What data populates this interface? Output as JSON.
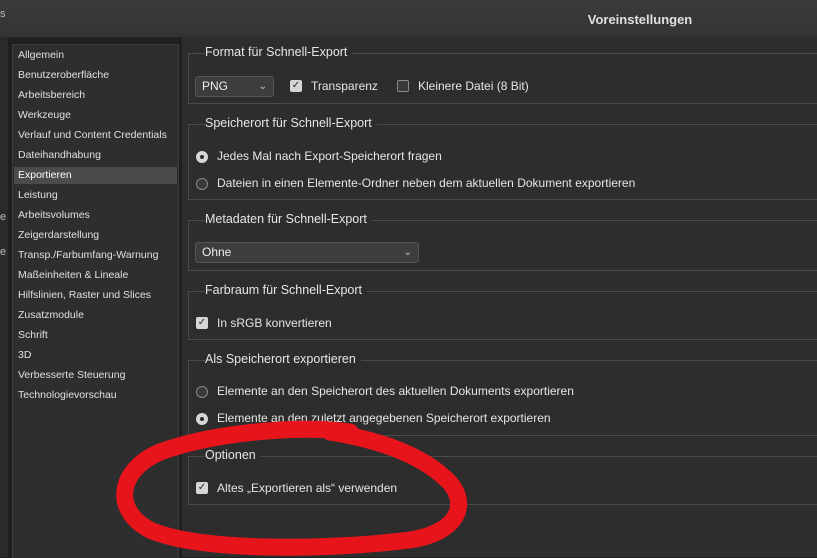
{
  "window": {
    "title": "Voreinstellungen"
  },
  "edge_glyphs": [
    "s",
    "e",
    "e"
  ],
  "sidebar": {
    "items": [
      {
        "label": "Allgemein"
      },
      {
        "label": "Benutzeroberfläche"
      },
      {
        "label": "Arbeitsbereich"
      },
      {
        "label": "Werkzeuge"
      },
      {
        "label": "Verlauf und Content Credentials"
      },
      {
        "label": "Dateihandhabung"
      },
      {
        "label": "Exportieren",
        "selected": true
      },
      {
        "label": "Leistung"
      },
      {
        "label": "Arbeitsvolumes"
      },
      {
        "label": "Zeigerdarstellung"
      },
      {
        "label": "Transp./Farbumfang-Warnung"
      },
      {
        "label": "Maßeinheiten & Lineale"
      },
      {
        "label": "Hilfslinien, Raster und Slices"
      },
      {
        "label": "Zusatzmodule"
      },
      {
        "label": "Schrift"
      },
      {
        "label": "3D"
      },
      {
        "label": "Verbesserte Steuerung"
      },
      {
        "label": "Technologievorschau"
      }
    ]
  },
  "quick_export_format": {
    "title": "Format für Schnell-Export",
    "format_value": "PNG",
    "transparency_label": "Transparenz",
    "transparency_checked": true,
    "smaller_file_label": "Kleinere Datei (8 Bit)",
    "smaller_file_checked": false
  },
  "quick_export_location": {
    "title": "Speicherort für Schnell-Export",
    "option_ask_label": "Jedes Mal nach Export-Speicherort fragen",
    "option_folder_label": "Dateien in einen Elemente-Ordner neben dem aktuellen Dokument exportieren",
    "selected": "ask"
  },
  "quick_export_metadata": {
    "title": "Metadaten für Schnell-Export",
    "value": "Ohne"
  },
  "quick_export_colorspace": {
    "title": "Farbraum für Schnell-Export",
    "srgb_label": "In sRGB konvertieren",
    "srgb_checked": true
  },
  "export_as_location": {
    "title": "Als Speicherort exportieren",
    "option_current_label": "Elemente an den Speicherort des aktuellen Dokuments exportieren",
    "option_last_label": "Elemente an den zuletzt angegebenen Speicherort exportieren",
    "selected": "last"
  },
  "options": {
    "title": "Optionen",
    "legacy_export_label": "Altes „Exportieren als“ verwenden",
    "legacy_export_checked": true
  },
  "colors": {
    "annotation": "#e8141b",
    "panel": "#2d2d2d",
    "selected_item": "#4b4b4b"
  },
  "icons": {
    "dropdown": "chevron-down-icon",
    "check": "checkmark-icon"
  }
}
